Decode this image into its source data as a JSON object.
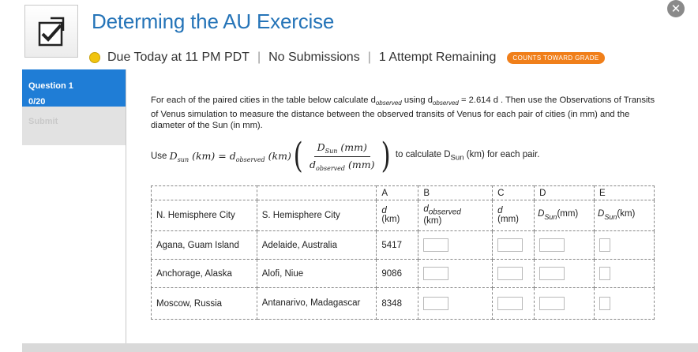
{
  "header": {
    "title": "Determing the AU Exercise",
    "due": "Due Today at 11 PM PDT",
    "submissions": "No Submissions",
    "attempts": "1 Attempt Remaining",
    "badge": "COUNTS TOWARD GRADE",
    "close_icon": "close-icon"
  },
  "sidebar": {
    "question_label": "Question 1",
    "score": "0/20",
    "submit_label": "Submit"
  },
  "instructions": {
    "p1": "For each of the paired cities in the table below calculate d",
    "p1_sub": "observed",
    "p2": " using d",
    "p2_sub": "observed",
    "p3": " = 2.614 d . Then use the Observations of Transits of Venus simulation to measure the distance between the observed transits of Venus for each pair of cities (in mm) and the diameter of the Sun (in mm)."
  },
  "formula": {
    "use": "Use",
    "lhs": "D",
    "lhs_sub": "sun",
    "lhs_unit": "(km) = d",
    "d_sub": "observed",
    "unit2": "(km)",
    "num": "D",
    "num_sub": "Sun",
    "num_unit": "(mm)",
    "den": "d",
    "den_sub": "observed",
    "den_unit": "(mm)",
    "after": "to calculate D",
    "after_sub": "Sun",
    "after_end": "(km) for each pair."
  },
  "table": {
    "letters": [
      "A",
      "B",
      "C",
      "D",
      "E"
    ],
    "headers": {
      "n_city": "N. Hemisphere City",
      "s_city": "S. Hemisphere City",
      "a_top": "d",
      "a_bottom": "(km)",
      "b_top": "d",
      "b_sub": "observed",
      "b_bottom": "(km)",
      "c_top": "d",
      "c_bottom": "(mm)",
      "d_main": "D",
      "d_sub": "Sun",
      "d_unit": "(mm)",
      "e_main": "D",
      "e_sub": "Sun",
      "e_unit": "(km)"
    },
    "rows": [
      {
        "n_city": "Agana, Guam Island",
        "s_city": "Adelaide, Australia",
        "d": "5417"
      },
      {
        "n_city": "Anchorage, Alaska",
        "s_city": "Alofi, Niue",
        "d": "9086"
      },
      {
        "n_city": "Moscow, Russia",
        "s_city": "Antanarivo, Madagascar",
        "d": "8348"
      }
    ]
  }
}
